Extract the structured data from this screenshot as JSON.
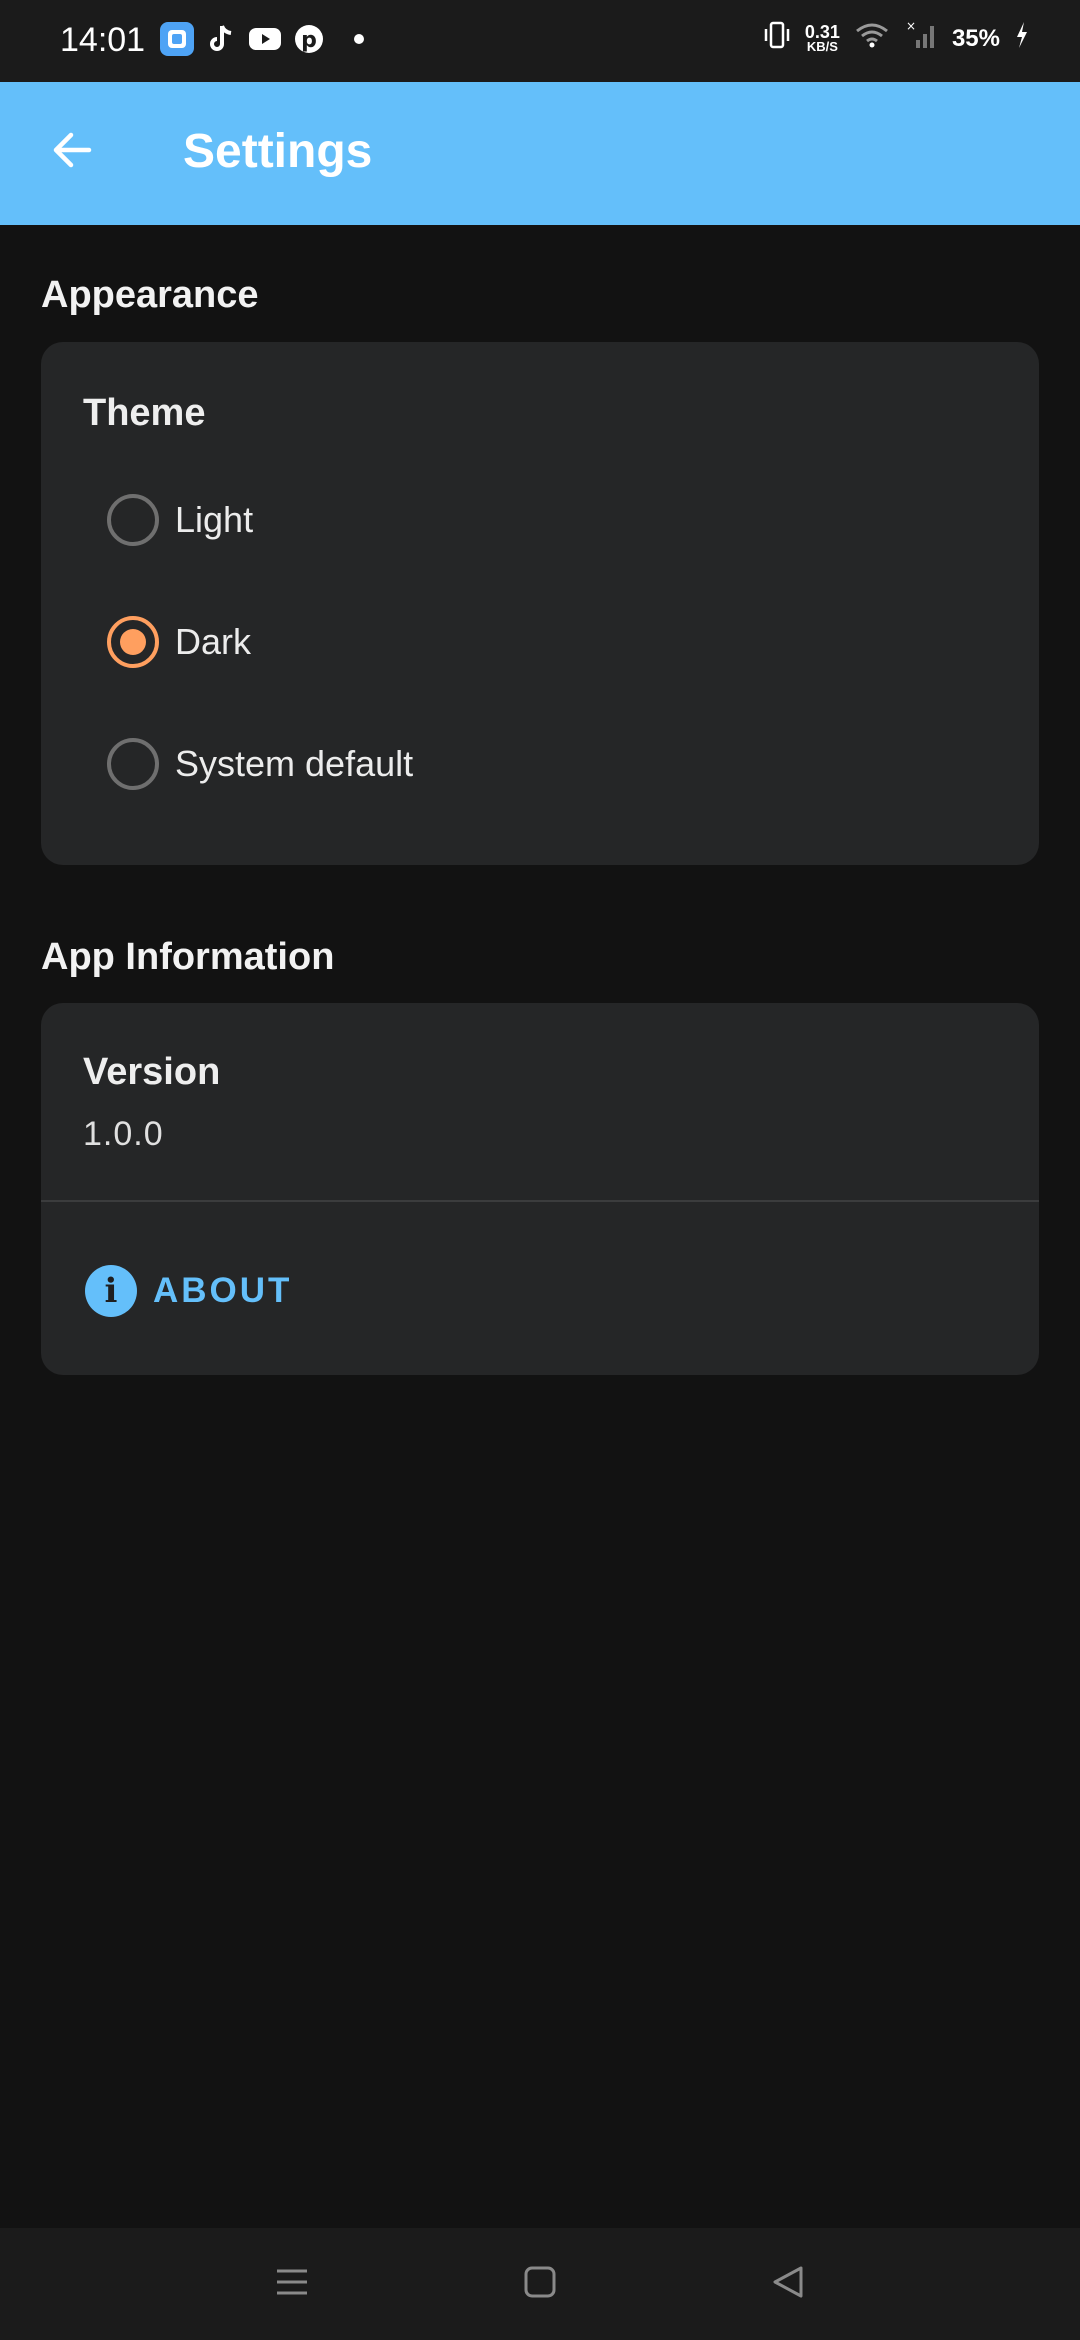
{
  "status_bar": {
    "time": "14:01",
    "network_speed_value": "0.31",
    "network_speed_unit": "KB/S",
    "battery": "35%",
    "notification_icons": [
      "app-icon",
      "tiktok-icon",
      "youtube-icon",
      "pinterest-icon"
    ]
  },
  "app_bar": {
    "title": "Settings",
    "background_color": "#64bffa"
  },
  "appearance": {
    "section_title": "Appearance",
    "theme_heading": "Theme",
    "options": [
      {
        "label": "Light",
        "selected": false
      },
      {
        "label": "Dark",
        "selected": true
      },
      {
        "label": "System default",
        "selected": false
      }
    ],
    "selected_color": "#ff9f5f"
  },
  "app_information": {
    "section_title": "App Information",
    "version_heading": "Version",
    "version_value": "1.0.0",
    "about_label": "ABOUT",
    "accent_color": "#64bffa"
  },
  "nav_bar": {
    "buttons": [
      "menu-icon",
      "home-icon",
      "back-triangle-icon"
    ]
  }
}
